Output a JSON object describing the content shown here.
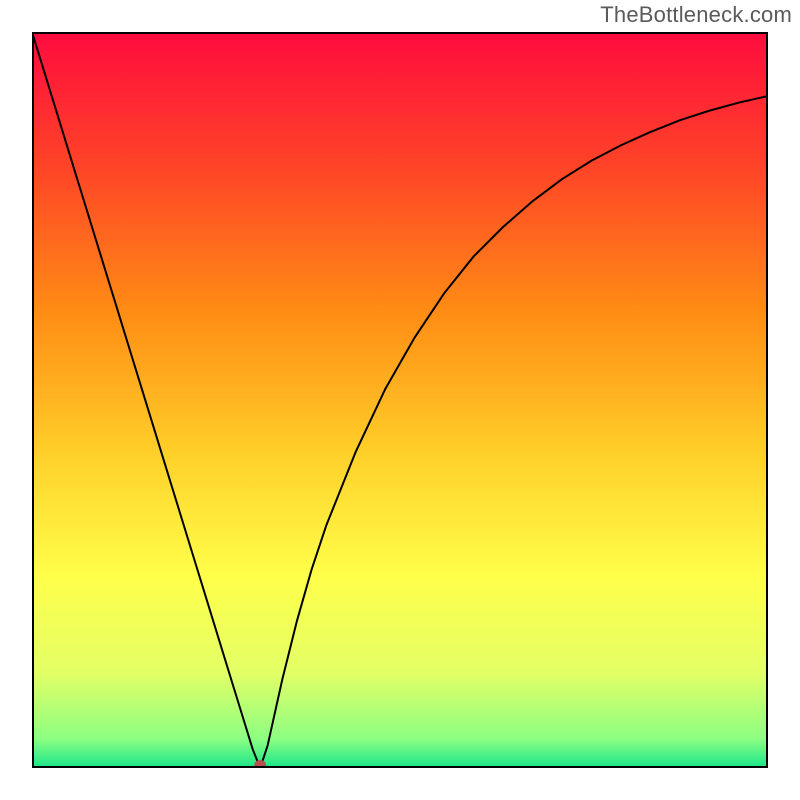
{
  "watermark": "TheBottleneck.com",
  "colors": {
    "gradient": [
      {
        "offset": 0,
        "color": "#ff0b3e"
      },
      {
        "offset": 18,
        "color": "#ff4328"
      },
      {
        "offset": 38,
        "color": "#ff8c14"
      },
      {
        "offset": 58,
        "color": "#ffd22a"
      },
      {
        "offset": 74,
        "color": "#ffff4a"
      },
      {
        "offset": 87,
        "color": "#e3ff66"
      },
      {
        "offset": 96,
        "color": "#8dff82"
      },
      {
        "offset": 100,
        "color": "#17e58a"
      }
    ],
    "curve": "#000000",
    "frame": "#000000",
    "marker": "#b85050"
  },
  "chart_data": {
    "type": "line",
    "title": "",
    "xlabel": "",
    "ylabel": "",
    "xlim": [
      0,
      100
    ],
    "ylim": [
      0,
      100
    ],
    "x": [
      0,
      2,
      4,
      6,
      8,
      10,
      12,
      14,
      16,
      18,
      20,
      22,
      24,
      26,
      28,
      30,
      31,
      32,
      34,
      36,
      38,
      40,
      44,
      48,
      52,
      56,
      60,
      64,
      68,
      72,
      76,
      80,
      84,
      88,
      92,
      96,
      100
    ],
    "values": [
      100,
      93.5,
      87,
      80.5,
      74,
      67.5,
      61,
      54.5,
      48,
      41.5,
      35,
      28.5,
      22,
      15.5,
      9,
      2.5,
      0,
      3,
      12,
      20,
      27,
      33,
      43,
      51.5,
      58.5,
      64.5,
      69.5,
      73.5,
      77,
      80,
      82.5,
      84.6,
      86.4,
      88,
      89.3,
      90.4,
      91.3
    ],
    "minimum_point": {
      "x": 31,
      "y": 0
    },
    "grid": false,
    "legend": false,
    "notes": "Left branch decreases approximately linearly from (0,100) to the minimum near x≈31. Right branch rises steeply then asymptotically toward ~91 at x=100. Axis tick labels not shown; values estimated from plot geometry on a 0–100 normalized scale."
  }
}
